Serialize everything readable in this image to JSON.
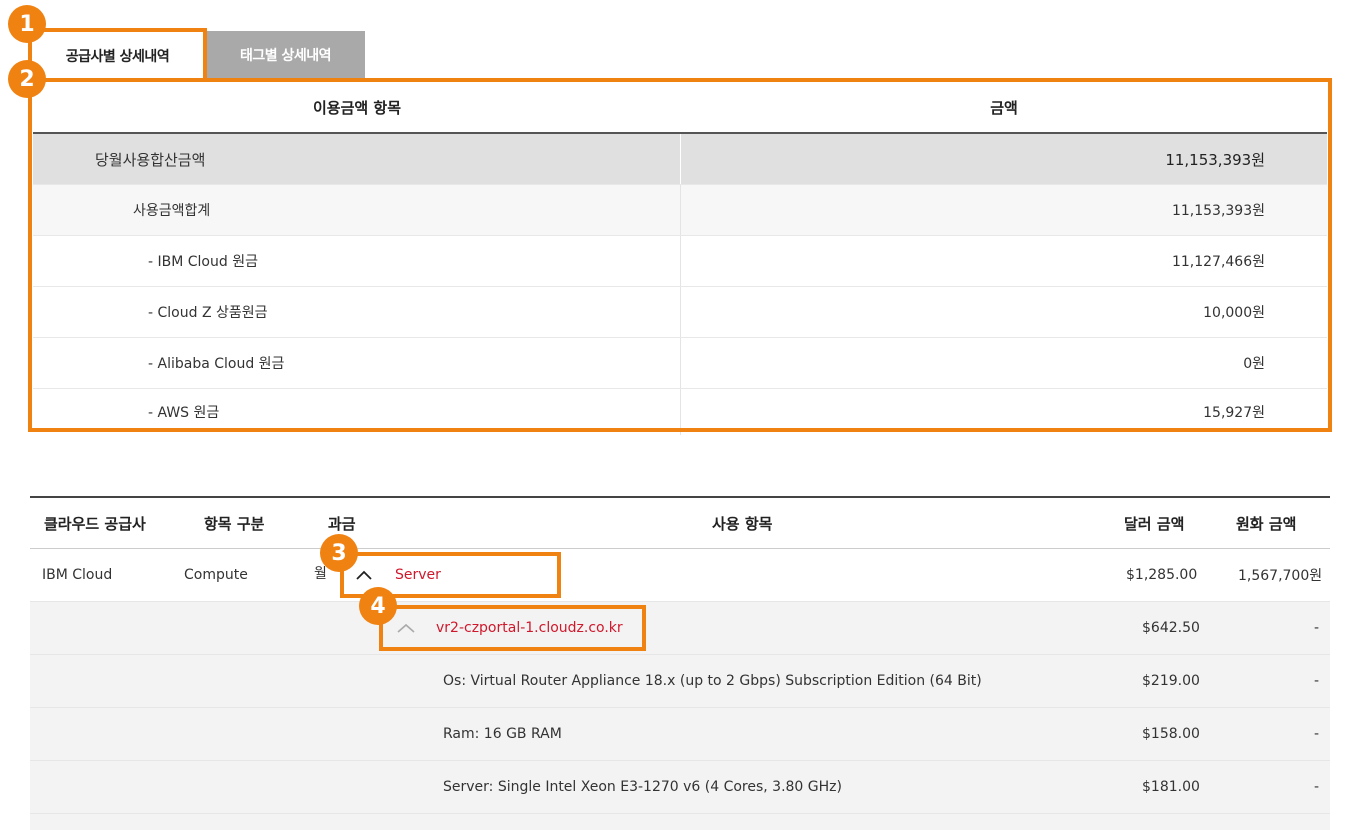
{
  "tabs": [
    {
      "label": "공급사별 상세내역",
      "active": true
    },
    {
      "label": "태그별 상세내역",
      "active": false
    }
  ],
  "badges": [
    "1",
    "2",
    "3",
    "4"
  ],
  "summary": {
    "headers": {
      "item": "이용금액 항목",
      "amount": "금액"
    },
    "rows": [
      {
        "label": "당월사용합산금액",
        "amount": "11,153,393원"
      },
      {
        "label": "사용금액합계",
        "amount": "11,153,393원"
      },
      {
        "label": "- IBM Cloud 원금",
        "amount": "11,127,466원"
      },
      {
        "label": "- Cloud Z 상품원금",
        "amount": "10,000원"
      },
      {
        "label": "- Alibaba Cloud 원금",
        "amount": "0원"
      },
      {
        "label": "- AWS 원금",
        "amount": "15,927원"
      }
    ]
  },
  "detail": {
    "headers": {
      "provider": "클라우드 공급사",
      "category": "항목 구분",
      "billing": "과금",
      "usage": "사용 항목",
      "usd": "달러 금액",
      "krw": "원화 금액"
    },
    "rows": [
      {
        "provider": "IBM Cloud",
        "category": "Compute",
        "billing": "월",
        "usage": "Server",
        "usd": "$1,285.00",
        "krw": "1,567,700원"
      },
      {
        "usage": "vr2-czportal-1.cloudz.co.kr",
        "usd": "$642.50",
        "krw": "-"
      },
      {
        "usage": "Os: Virtual Router Appliance 18.x (up to 2 Gbps) Subscription Edition (64 Bit)",
        "usd": "$219.00",
        "krw": "-"
      },
      {
        "usage": "Ram: 16 GB RAM",
        "usd": "$158.00",
        "krw": "-"
      },
      {
        "usage": "Server: Single Intel Xeon E3-1270 v6 (4 Cores, 3.80 GHz)",
        "usd": "$181.00",
        "krw": "-"
      }
    ]
  },
  "colors": {
    "accent": "#f08212",
    "link": "#d0182c",
    "tab_inactive": "#a9a9a9",
    "total_row": "#e0e0e0"
  },
  "icons": {
    "expand": "chevron-up-icon"
  }
}
